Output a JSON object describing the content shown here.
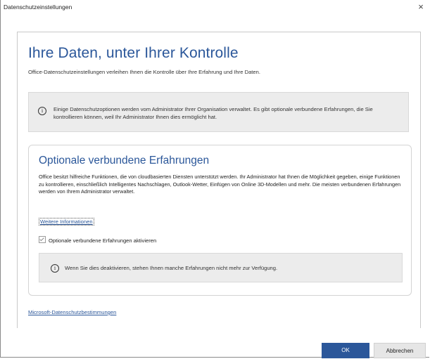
{
  "window": {
    "title": "Datenschutzeinstellungen",
    "close_glyph": "×"
  },
  "header": {
    "title": "Ihre Daten, unter Ihrer Kontrolle",
    "subtitle": "Office-Datenschutzeinstellungen verleihen Ihnen die Kontrolle über Ihre Erfahrung und Ihre Daten."
  },
  "admin_notice": {
    "icon": "info-icon",
    "text": "Einige Datenschutzoptionen werden vom Administrator Ihrer Organisation verwaltet. Es gibt optionale verbundene Erfahrungen, die Sie kontrollieren können, weil Ihr Administrator Ihnen dies ermöglicht hat."
  },
  "connected_experiences": {
    "title": "Optionale verbundene Erfahrungen",
    "description": "Office besitzt hilfreiche Funktionen, die von cloudbasierten Diensten unterstützt werden. Ihr Administrator hat Ihnen die Möglichkeit gegeben, einige Funktionen zu kontrollieren, einschließlich Intelligentes Nachschlagen, Outlook-Wetter, Einfügen von Online 3D-Modellen und mehr. Die meisten verbundenen Erfahrungen werden von Ihrem Administrator verwaltet.",
    "learn_more": "Weitere Informationen",
    "checkbox_label": "Optionale verbundene Erfahrungen aktivieren",
    "checkbox_checked": true,
    "warning_text": "Wenn Sie dies deaktivieren, stehen Ihnen manche Erfahrungen nicht mehr zur Verfügung."
  },
  "privacy_link": "Microsoft-Datenschutzbestimmungen",
  "footer": {
    "ok_label": "OK",
    "cancel_label": "Abbrechen"
  },
  "colors": {
    "accent": "#2b579a",
    "notice_bg": "#ececec"
  }
}
